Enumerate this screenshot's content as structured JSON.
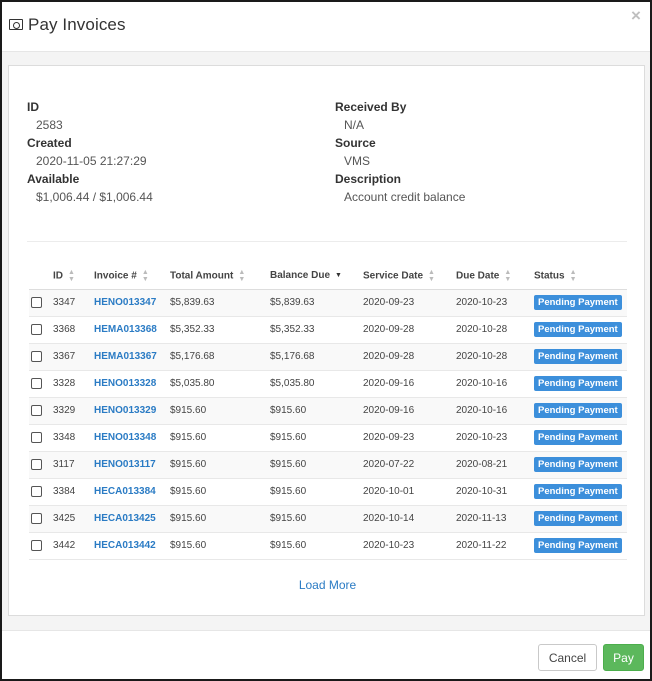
{
  "modal": {
    "title": "Pay Invoices",
    "close_glyph": "×",
    "title_icon": "money-icon"
  },
  "details": {
    "left": [
      {
        "label": "ID",
        "value": "2583"
      },
      {
        "label": "Created",
        "value": "2020-11-05 21:27:29"
      },
      {
        "label": "Available",
        "value": "$1,006.44 / $1,006.44"
      }
    ],
    "right": [
      {
        "label": "Received By",
        "value": "N/A"
      },
      {
        "label": "Source",
        "value": "VMS"
      },
      {
        "label": "Description",
        "value": "Account credit balance"
      }
    ]
  },
  "table": {
    "columns": [
      "ID",
      "Invoice #",
      "Total Amount",
      "Balance Due",
      "Service Date",
      "Due Date",
      "Status"
    ],
    "sorted_column": "Balance Due",
    "rows": [
      {
        "id": "3347",
        "invoice": "HENO013347",
        "total": "$5,839.63",
        "balance": "$5,839.63",
        "service": "2020-09-23",
        "due": "2020-10-23",
        "status": "Pending Payment"
      },
      {
        "id": "3368",
        "invoice": "HEMA013368",
        "total": "$5,352.33",
        "balance": "$5,352.33",
        "service": "2020-09-28",
        "due": "2020-10-28",
        "status": "Pending Payment"
      },
      {
        "id": "3367",
        "invoice": "HEMA013367",
        "total": "$5,176.68",
        "balance": "$5,176.68",
        "service": "2020-09-28",
        "due": "2020-10-28",
        "status": "Pending Payment"
      },
      {
        "id": "3328",
        "invoice": "HENO013328",
        "total": "$5,035.80",
        "balance": "$5,035.80",
        "service": "2020-09-16",
        "due": "2020-10-16",
        "status": "Pending Payment"
      },
      {
        "id": "3329",
        "invoice": "HENO013329",
        "total": "$915.60",
        "balance": "$915.60",
        "service": "2020-09-16",
        "due": "2020-10-16",
        "status": "Pending Payment"
      },
      {
        "id": "3348",
        "invoice": "HENO013348",
        "total": "$915.60",
        "balance": "$915.60",
        "service": "2020-09-23",
        "due": "2020-10-23",
        "status": "Pending Payment"
      },
      {
        "id": "3117",
        "invoice": "HENO013117",
        "total": "$915.60",
        "balance": "$915.60",
        "service": "2020-07-22",
        "due": "2020-08-21",
        "status": "Pending Payment"
      },
      {
        "id": "3384",
        "invoice": "HECA013384",
        "total": "$915.60",
        "balance": "$915.60",
        "service": "2020-10-01",
        "due": "2020-10-31",
        "status": "Pending Payment"
      },
      {
        "id": "3425",
        "invoice": "HECA013425",
        "total": "$915.60",
        "balance": "$915.60",
        "service": "2020-10-14",
        "due": "2020-11-13",
        "status": "Pending Payment"
      },
      {
        "id": "3442",
        "invoice": "HECA013442",
        "total": "$915.60",
        "balance": "$915.60",
        "service": "2020-10-23",
        "due": "2020-11-22",
        "status": "Pending Payment"
      }
    ]
  },
  "load_more_label": "Load More",
  "footer": {
    "cancel_label": "Cancel",
    "pay_label": "Pay"
  },
  "colors": {
    "link": "#2a7bc4",
    "status_badge": "#3c8fdb",
    "pay_button": "#5cb85c"
  }
}
